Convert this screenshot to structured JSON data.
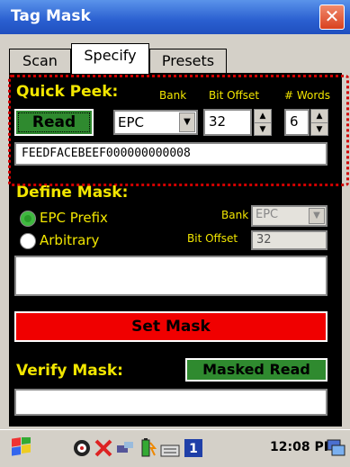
{
  "window": {
    "title": "Tag Mask",
    "close_glyph": "✕"
  },
  "tabs": [
    {
      "label": "Scan"
    },
    {
      "label": "Specify"
    },
    {
      "label": "Presets"
    }
  ],
  "quick_peek": {
    "heading": "Quick Peek:",
    "bank_label": "Bank",
    "bit_offset_label": "Bit Offset",
    "words_label": "# Words",
    "read_button": "Read",
    "bank_value": "EPC",
    "bit_offset_value": "32",
    "words_value": "6",
    "data": "FEEDFACEBEEF000000000008"
  },
  "define_mask": {
    "heading": "Define Mask:",
    "option_epc_prefix": "EPC Prefix",
    "option_arbitrary": "Arbitrary",
    "selected": "EPC Prefix",
    "bank_label": "Bank",
    "bank_value": "EPC",
    "bit_offset_label": "Bit Offset",
    "bit_offset_value": "32",
    "mask_value": ""
  },
  "set_mask_button": "Set Mask",
  "verify": {
    "heading": "Verify Mask:",
    "masked_read_button": "Masked Read",
    "result": ""
  },
  "taskbar": {
    "clock": "12:08 PM",
    "icons": [
      "start-flag-icon",
      "network-icon",
      "tools-icon",
      "connection-icon",
      "battery-icon",
      "keyboard-icon",
      "number-one-icon",
      "desktop-icon"
    ]
  },
  "colors": {
    "accent_text": "#f2e600",
    "read_green": "#2f8a2f",
    "set_mask_red": "#f00000",
    "highlight_dotted": "#d10000",
    "titlebar_blue": "#2a5fd0"
  }
}
